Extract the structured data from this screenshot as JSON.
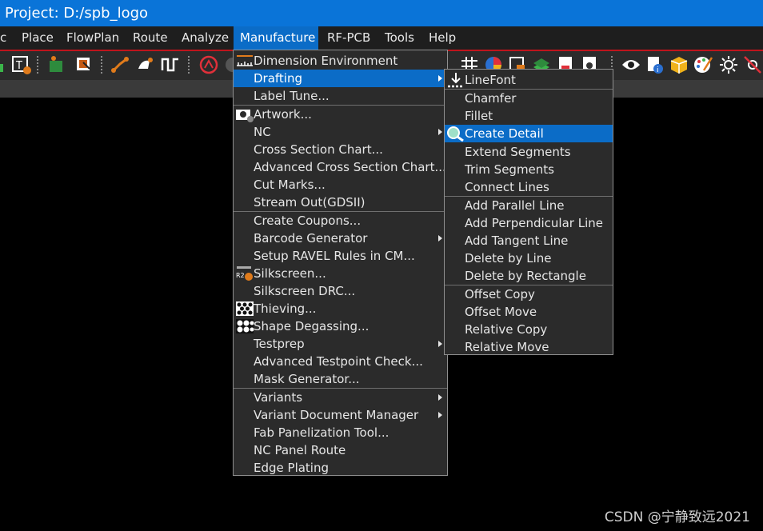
{
  "window": {
    "title": "Project: D:/spb_logo"
  },
  "menubar": {
    "items": [
      {
        "label": "c"
      },
      {
        "label": "Place"
      },
      {
        "label": "FlowPlan"
      },
      {
        "label": "Route"
      },
      {
        "label": "Analyze"
      },
      {
        "label": "Manufacture"
      },
      {
        "label": "RF-PCB"
      },
      {
        "label": "Tools"
      },
      {
        "label": "Help"
      }
    ]
  },
  "manufacture_menu": {
    "items": [
      {
        "label": "Dimension Environment"
      },
      {
        "label": "Drafting"
      },
      {
        "label": "Label Tune..."
      },
      {
        "label": "Artwork..."
      },
      {
        "label": "NC"
      },
      {
        "label": "Cross Section Chart..."
      },
      {
        "label": "Advanced Cross Section Chart..."
      },
      {
        "label": "Cut Marks..."
      },
      {
        "label": "Stream Out(GDSII)"
      },
      {
        "label": "Create Coupons..."
      },
      {
        "label": "Barcode Generator"
      },
      {
        "label": "Setup RAVEL Rules in CM..."
      },
      {
        "label": "Silkscreen..."
      },
      {
        "label": "Silkscreen DRC..."
      },
      {
        "label": "Thieving..."
      },
      {
        "label": "Shape Degassing..."
      },
      {
        "label": "Testprep"
      },
      {
        "label": "Advanced Testpoint Check..."
      },
      {
        "label": "Mask Generator..."
      },
      {
        "label": "Variants"
      },
      {
        "label": "Variant Document Manager"
      },
      {
        "label": "Fab Panelization Tool..."
      },
      {
        "label": "NC Panel Route"
      },
      {
        "label": "Edge Plating"
      }
    ],
    "silkscreen_icon_text": "R2"
  },
  "drafting_menu": {
    "items": [
      {
        "label": "LineFont"
      },
      {
        "label": "Chamfer"
      },
      {
        "label": "Fillet"
      },
      {
        "label": "Create Detail"
      },
      {
        "label": "Extend Segments"
      },
      {
        "label": "Trim Segments"
      },
      {
        "label": "Connect Lines"
      },
      {
        "label": "Add Parallel Line"
      },
      {
        "label": "Add Perpendicular Line"
      },
      {
        "label": "Add Tangent Line"
      },
      {
        "label": "Delete by Line"
      },
      {
        "label": "Delete by Rectangle"
      },
      {
        "label": "Offset Copy"
      },
      {
        "label": "Offset Move"
      },
      {
        "label": "Relative Copy"
      },
      {
        "label": "Relative Move"
      }
    ]
  },
  "watermark": "CSDN @宁静致远2021",
  "colors": {
    "accent": "#0b6cc7",
    "titlebar": "#0a74d8",
    "menu_bg": "#2b2b2b",
    "redline": "#c0141c"
  }
}
